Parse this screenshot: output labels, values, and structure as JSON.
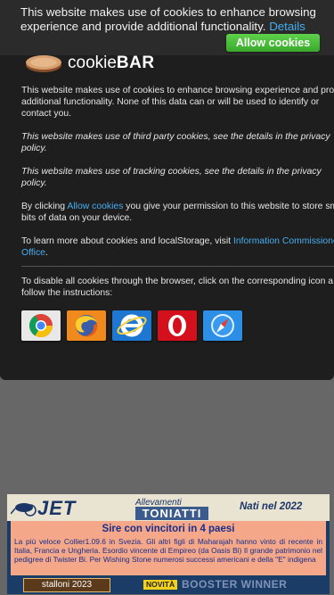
{
  "topbar": {
    "message": "This website makes use of cookies to enhance browsing experience and provide additional functionality.",
    "details_link": "Details",
    "allow_button": "Allow cookies"
  },
  "panel": {
    "logo_prefix": "cookie",
    "logo_suffix": "BAR",
    "p1_line1": "This website makes use of cookies to enhance browsing experience and prov",
    "p1_line2": "additional functionality. None of this data can or will be used to identify or",
    "p1_line3": "contact you.",
    "p2_line1": "This website makes use of third party cookies, see the details in the privacy",
    "p2_line2": "policy.",
    "p3_line1": "This website makes use of tracking cookies, see the details in the privacy",
    "p3_line2": "policy.",
    "p4_before": "By clicking ",
    "p4_link": "Allow cookies",
    "p4_after": " you give your permission to this website to store sm",
    "p4_line2": "bits of data on your device.",
    "p5_before": "To learn more about cookies and localStorage, visit ",
    "p5_link": "Information Commissione",
    "p5_line2_link": "Office",
    "p5_line2_after": ".",
    "p6_line1": "To disable all cookies through the browser, click on the corresponding icon a",
    "p6_line2": "follow the instructions:",
    "browsers": [
      "chrome-icon",
      "firefox-icon",
      "internet-explorer-icon",
      "opera-icon",
      "safari-icon"
    ]
  },
  "ad": {
    "brand": "JET",
    "allevamenti": "Allevamenti",
    "toniatti": "TONIATTI",
    "nati": "Nati nel 2022",
    "title": "Sire con vincitori in 4 paesi",
    "body": "La più veloce Collier1.09.6 in Svezia. Gli altri figli di Maharajah hanno vinto di recente in Italia, Francia e Ungheria. Esordio vincente di Empireo (da Oasis Bi) Il grande patrimonio nel pedigree di Twister Bi. Per Wishing Stone numerosi successi americani e della \"E\" indigena",
    "stalloni": "stalloni 2023",
    "novita": "NOVITÀ",
    "booster": "BOOSTER WINNER"
  },
  "colors": {
    "accent_link": "#46aef0",
    "allow_green": "#39a82b",
    "panel_bg": "#1e1e1e",
    "ad_navy": "#1c3c68",
    "ad_salmon": "#f4a889"
  }
}
